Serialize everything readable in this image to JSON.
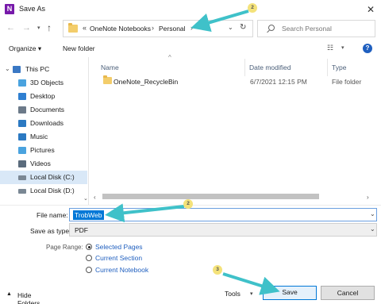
{
  "window": {
    "title": "Save As",
    "app_icon_letter": "N",
    "close_glyph": "✕"
  },
  "address": {
    "breadcrumbs": [
      "OneNote Notebooks",
      "Personal"
    ],
    "overflow": "«"
  },
  "search": {
    "placeholder": "Search Personal"
  },
  "toolbar": {
    "organize_label": "Organize ▾",
    "new_folder_label": "New folder",
    "help_label": "?"
  },
  "navigation": {
    "items": [
      {
        "label": "This PC",
        "icon": "computer-icon",
        "color": "#3a78c4"
      },
      {
        "label": "3D Objects",
        "icon": "3d-objects-icon",
        "color": "#4aa3df"
      },
      {
        "label": "Desktop",
        "icon": "desktop-icon",
        "color": "#2f7fd1"
      },
      {
        "label": "Documents",
        "icon": "documents-icon",
        "color": "#6c7a89"
      },
      {
        "label": "Downloads",
        "icon": "downloads-icon",
        "color": "#2b79c2"
      },
      {
        "label": "Music",
        "icon": "music-icon",
        "color": "#2b79c2"
      },
      {
        "label": "Pictures",
        "icon": "pictures-icon",
        "color": "#4aa3df"
      },
      {
        "label": "Videos",
        "icon": "videos-icon",
        "color": "#5a6b7c"
      },
      {
        "label": "Local Disk (C:)",
        "icon": "drive-icon",
        "color": "#7a8794"
      },
      {
        "label": "Local Disk (D:)",
        "icon": "drive-icon",
        "color": "#7a8794"
      }
    ],
    "selected": "Local Disk (C:)"
  },
  "file_list": {
    "columns": {
      "name": "Name",
      "date": "Date modified",
      "type": "Type"
    },
    "rows": [
      {
        "name": "OneNote_RecycleBin",
        "date": "6/7/2021 12:15 PM",
        "type": "File folder"
      }
    ]
  },
  "form": {
    "filename_label": "File name:",
    "filename_value": "TrobWeb",
    "savetype_label": "Save as type:",
    "savetype_value": "PDF",
    "page_range_label": "Page Range:",
    "page_range_options": [
      "Selected Pages",
      "Current Section",
      "Current Notebook"
    ],
    "page_range_selected": "Selected Pages"
  },
  "footer": {
    "hide_folders_label": "Hide Folders",
    "tools_label": "Tools",
    "save_label": "Save",
    "cancel_label": "Cancel"
  },
  "annotations": {
    "badges": [
      "2",
      "2",
      "3"
    ],
    "arrow_color": "#3fc1c9"
  }
}
